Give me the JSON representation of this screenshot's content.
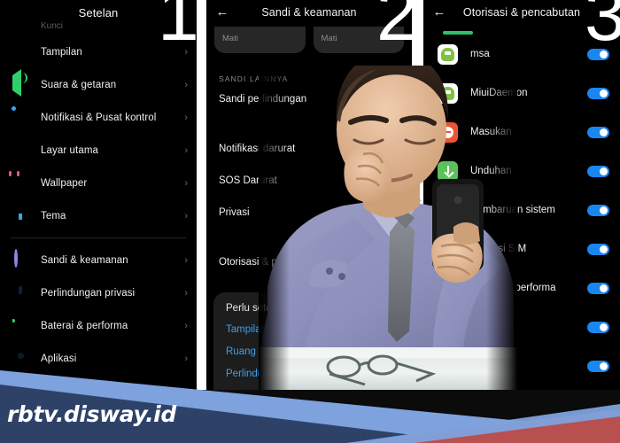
{
  "watermark": "rbtv.disway.id",
  "step_numbers": {
    "one": "1",
    "two": "2",
    "three": "3"
  },
  "colors": {
    "toggle_on": "#1a86f0",
    "link": "#3ba0f0",
    "panel_bg": "#000000",
    "banner_navy": "#2e4268",
    "banner_blue": "#7da2dd",
    "banner_red": "#b8504f"
  },
  "panel1": {
    "title": "Setelan",
    "cut_label": "Kunci",
    "items": [
      {
        "label": "Tampilan",
        "icon": "sun-icon",
        "chevron": "›"
      },
      {
        "label": "Suara & getaran",
        "icon": "speaker-icon",
        "chevron": "›"
      },
      {
        "label": "Notifikasi & Pusat kontrol",
        "icon": "notification-icon",
        "chevron": "›"
      },
      {
        "label": "Layar utama",
        "icon": "home-icon",
        "chevron": "›"
      },
      {
        "label": "Wallpaper",
        "icon": "flower-icon",
        "chevron": "›"
      },
      {
        "label": "Tema",
        "icon": "theme-icon",
        "chevron": "›"
      }
    ],
    "items2": [
      {
        "label": "Sandi & keamanan",
        "icon": "lock-icon",
        "chevron": "›"
      },
      {
        "label": "Perlindungan privasi",
        "icon": "shield-icon",
        "chevron": "›"
      },
      {
        "label": "Baterai & performa",
        "icon": "battery-icon",
        "chevron": "›"
      },
      {
        "label": "Aplikasi",
        "icon": "apps-icon",
        "chevron": "›"
      }
    ],
    "trailing_chevron": "›"
  },
  "panel2": {
    "title": "Sandi & keamanan",
    "back_icon": "←",
    "cards": [
      {
        "status": "Mati"
      },
      {
        "status": "Mati"
      }
    ],
    "section_header": "SANDI LAINNYA",
    "items": [
      {
        "label": "Sandi perlindungan",
        "chevron": "›"
      },
      {
        "label": "Notifikasi darurat",
        "chevron": ""
      },
      {
        "label": "SOS Darurat",
        "chevron": ""
      },
      {
        "label": "Privasi",
        "chevron": ""
      },
      {
        "label": "Otorisasi & pencabutan",
        "chevron": ""
      }
    ],
    "sheet": {
      "question": "Perlu setelan lainnya?",
      "links": [
        "Tampilan",
        "Ruang kedua",
        "Perlindungan privasi"
      ]
    }
  },
  "panel3": {
    "title": "Otorisasi & pencabutan",
    "back_icon": "←",
    "apps": [
      {
        "name": "msa",
        "icon": "android-icon",
        "toggle": "on"
      },
      {
        "name": "MiuiDaemon",
        "icon": "android-icon",
        "toggle": "on"
      },
      {
        "name": "Masukan",
        "icon": "minus-circle-icon",
        "toggle": "on"
      },
      {
        "name": "Unduhan",
        "icon": "download-icon",
        "toggle": "on"
      },
      {
        "name": "Pembaruan sistem",
        "icon": "triangle-icon",
        "toggle": "on"
      },
      {
        "name": "Aktivasi SIM",
        "icon": "sim-icon",
        "toggle": "on"
      },
      {
        "name": "Baterai & performa",
        "icon": "battery-icon",
        "toggle": "on"
      },
      {
        "name": "",
        "icon": "app-icon",
        "toggle": "on"
      },
      {
        "name": "",
        "icon": "app-icon",
        "toggle": "on"
      }
    ]
  }
}
